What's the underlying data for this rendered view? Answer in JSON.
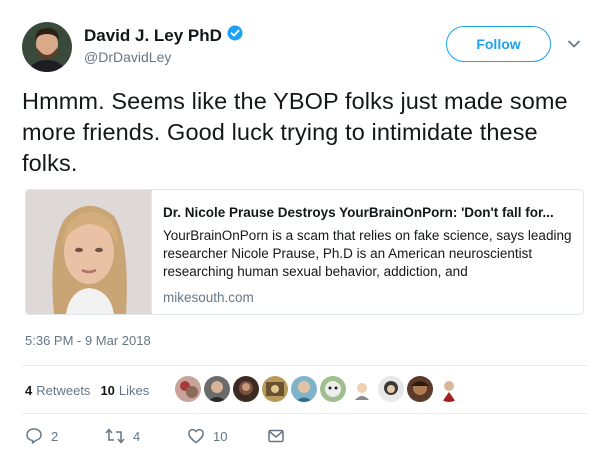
{
  "author": {
    "name": "David J. Ley PhD",
    "handle": "@DrDavidLey",
    "verified_icon": "verified-badge-icon"
  },
  "follow_label": "Follow",
  "tweet_text": "Hmmm. Seems like the YBOP folks just made some more friends. Good luck trying to intimidate these folks.",
  "card": {
    "title": "Dr. Nicole Prause Destroys YourBrainOnPorn: 'Don't fall for...",
    "description": "YourBrainOnPorn is a scam that relies on fake science, says leading researcher   Nicole Prause, Ph.D is an American neuroscientist researching human sexual behavior, addiction, and",
    "domain": "mikesouth.com"
  },
  "timestamp": "5:36 PM - 9 Mar 2018",
  "stats": {
    "retweets_count": "4",
    "retweets_label": "Retweets",
    "likes_count": "10",
    "likes_label": "Likes"
  },
  "actions": {
    "reply_count": "2",
    "retweet_count": "4",
    "like_count": "10"
  },
  "colors": {
    "accent": "#1da1f2",
    "text": "#14171a",
    "muted": "#657786",
    "border": "#e1e8ed"
  }
}
